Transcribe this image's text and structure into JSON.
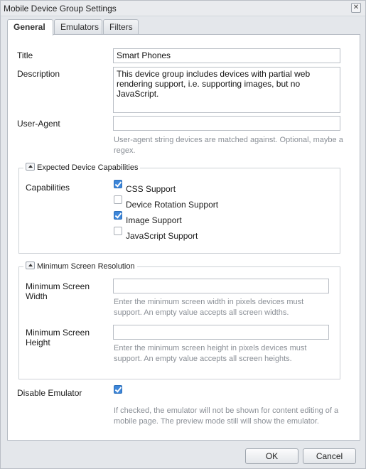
{
  "dialog": {
    "title": "Mobile Device Group Settings"
  },
  "tabs": [
    {
      "label": "General",
      "active": true
    },
    {
      "label": "Emulators",
      "active": false
    },
    {
      "label": "Filters",
      "active": false
    }
  ],
  "fields": {
    "title": {
      "label": "Title",
      "value": "Smart Phones"
    },
    "description": {
      "label": "Description",
      "value": "This device group includes devices with partial web rendering support, i.e. supporting images, but no JavaScript."
    },
    "user_agent": {
      "label": "User-Agent",
      "value": "",
      "help": "User-agent string devices are matched against. Optional, maybe a regex."
    }
  },
  "capabilities_section": {
    "legend": "Expected Device Capabilities",
    "label": "Capabilities",
    "items": [
      {
        "label": "CSS Support",
        "checked": true
      },
      {
        "label": "Device Rotation Support",
        "checked": false
      },
      {
        "label": "Image Support",
        "checked": true
      },
      {
        "label": "JavaScript Support",
        "checked": false
      }
    ]
  },
  "resolution_section": {
    "legend": "Minimum Screen Resolution",
    "width": {
      "label": "Minimum Screen Width",
      "value": "",
      "help": "Enter the minimum screen width in pixels devices must support. An empty value accepts all screen widths."
    },
    "height": {
      "label": "Minimum Screen Height",
      "value": "",
      "help": "Enter the minimum screen height in pixels devices must support. An empty value accepts all screen heights."
    }
  },
  "disable_emulator": {
    "label": "Disable Emulator",
    "checked": true,
    "help": "If checked, the emulator will not be shown for content editing of a mobile page. The preview mode still will show the emulator."
  },
  "footer": {
    "ok_label": "OK",
    "cancel_label": "Cancel"
  },
  "icons": {
    "close": "close-icon",
    "collapse": "collapse-arrow-icon",
    "check": "checkmark-icon"
  },
  "colors": {
    "checkbox_checked": "#3d86d9",
    "help_text": "#8a8f96"
  }
}
